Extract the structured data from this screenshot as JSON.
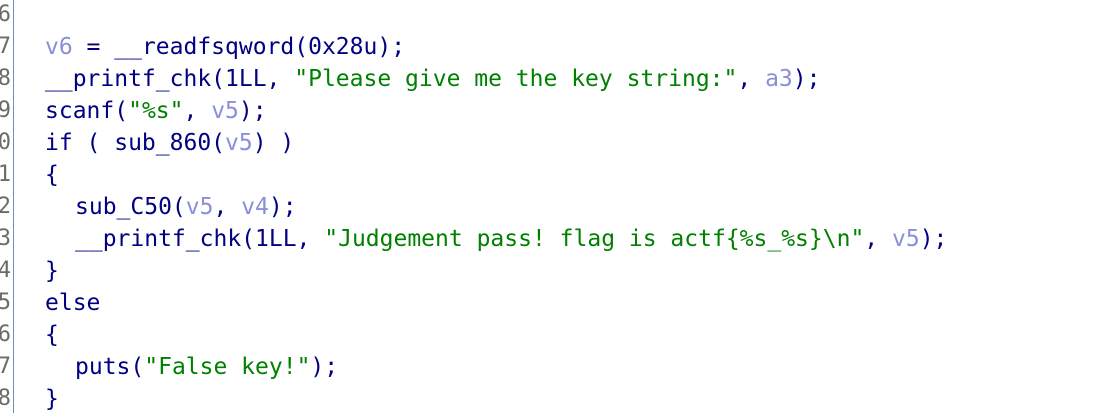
{
  "line_numbers": [
    "6",
    "7",
    "8",
    "9",
    "0",
    "1",
    "2",
    "3",
    "4",
    "5",
    "6",
    "7",
    "8"
  ],
  "lines": [
    {
      "indent": false,
      "tokens": [
        {
          "t": "var",
          "v": "v6"
        },
        {
          "t": "tx",
          "v": " = __readfsqword(0x28u);"
        }
      ]
    },
    {
      "indent": false,
      "tokens": [
        {
          "t": "tx",
          "v": "__printf_chk(1LL, "
        },
        {
          "t": "str",
          "v": "\"Please give me the key string:\""
        },
        {
          "t": "tx",
          "v": ", "
        },
        {
          "t": "var",
          "v": "a3"
        },
        {
          "t": "tx",
          "v": ");"
        }
      ]
    },
    {
      "indent": false,
      "tokens": [
        {
          "t": "tx",
          "v": "scanf("
        },
        {
          "t": "str",
          "v": "\"%s\""
        },
        {
          "t": "tx",
          "v": ", "
        },
        {
          "t": "var",
          "v": "v5"
        },
        {
          "t": "tx",
          "v": ");"
        }
      ]
    },
    {
      "indent": false,
      "tokens": [
        {
          "t": "tx",
          "v": "if ( sub_860("
        },
        {
          "t": "var",
          "v": "v5"
        },
        {
          "t": "tx",
          "v": ") )"
        }
      ]
    },
    {
      "indent": false,
      "tokens": [
        {
          "t": "tx",
          "v": "{"
        }
      ]
    },
    {
      "indent": true,
      "tokens": [
        {
          "t": "tx",
          "v": "sub_C50("
        },
        {
          "t": "var",
          "v": "v5"
        },
        {
          "t": "tx",
          "v": ", "
        },
        {
          "t": "var",
          "v": "v4"
        },
        {
          "t": "tx",
          "v": ");"
        }
      ]
    },
    {
      "indent": true,
      "tokens": [
        {
          "t": "tx",
          "v": "__printf_chk(1LL, "
        },
        {
          "t": "str",
          "v": "\"Judgement pass! flag is actf{%s_%s}\\n\""
        },
        {
          "t": "tx",
          "v": ", "
        },
        {
          "t": "var",
          "v": "v5"
        },
        {
          "t": "tx",
          "v": ");"
        }
      ]
    },
    {
      "indent": false,
      "tokens": [
        {
          "t": "tx",
          "v": "}"
        }
      ]
    },
    {
      "indent": false,
      "tokens": [
        {
          "t": "tx",
          "v": "else"
        }
      ]
    },
    {
      "indent": false,
      "tokens": [
        {
          "t": "tx",
          "v": "{"
        }
      ]
    },
    {
      "indent": true,
      "tokens": [
        {
          "t": "tx",
          "v": "puts("
        },
        {
          "t": "str",
          "v": "\"False key!\""
        },
        {
          "t": "tx",
          "v": ");"
        }
      ]
    },
    {
      "indent": false,
      "tokens": [
        {
          "t": "tx",
          "v": "}"
        }
      ]
    }
  ],
  "colors": {
    "text": "#000080",
    "variable": "#8a8fd6",
    "string": "#008000",
    "line_number": "#6b6b6b",
    "gutter_border": "#6b8fc5"
  }
}
